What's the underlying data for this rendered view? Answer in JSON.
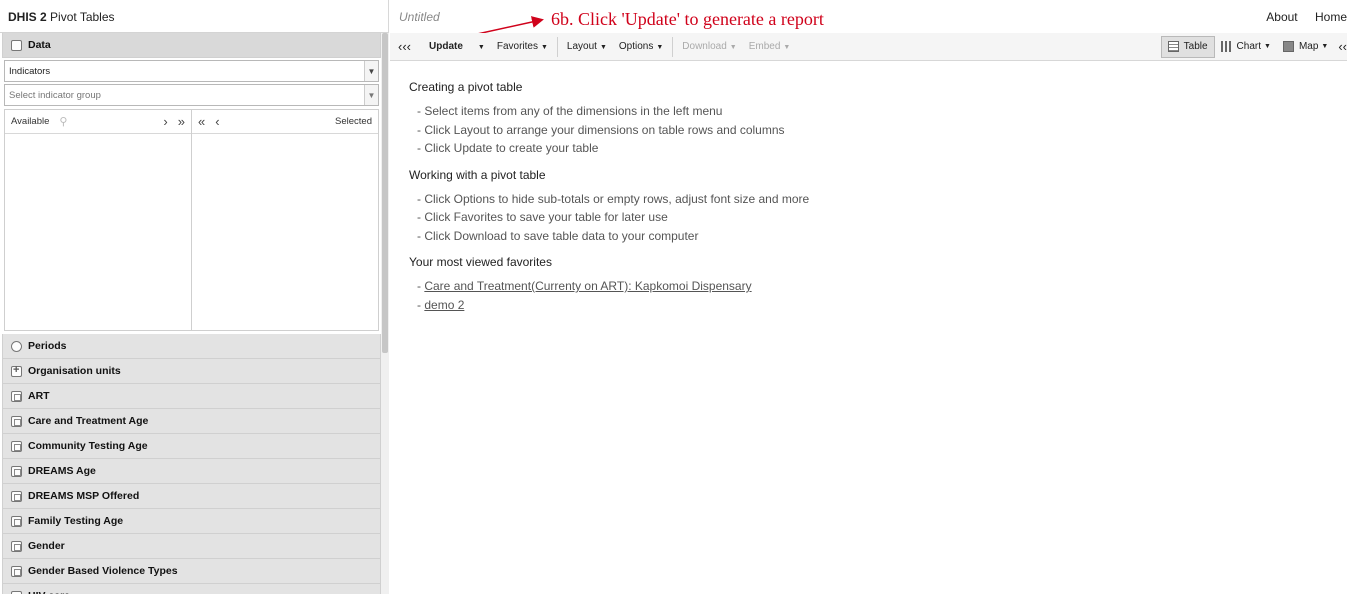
{
  "app": {
    "brand_bold": "DHIS 2",
    "brand_rest": "Pivot Tables"
  },
  "report_title": "Untitled",
  "topnav": {
    "about": "About",
    "home": "Home"
  },
  "annotation": {
    "text": "6b. Click 'Update' to generate a report",
    "color": "#d0021b"
  },
  "data_panel": {
    "title": "Data",
    "type_select": "Indicators",
    "group_placeholder": "Select indicator group",
    "available_label": "Available",
    "selected_label": "Selected"
  },
  "dimensions": [
    {
      "label": "Periods",
      "icon": "clock-icon"
    },
    {
      "label": "Organisation units",
      "icon": "plus-icon"
    },
    {
      "label": "ART",
      "icon": "grid-icon"
    },
    {
      "label": "Care and Treatment Age",
      "icon": "grid-icon"
    },
    {
      "label": "Community Testing Age",
      "icon": "grid-icon"
    },
    {
      "label": "DREAMS Age",
      "icon": "grid-icon"
    },
    {
      "label": "DREAMS MSP Offered",
      "icon": "grid-icon"
    },
    {
      "label": "Family Testing Age",
      "icon": "grid-icon"
    },
    {
      "label": "Gender",
      "icon": "grid-icon"
    },
    {
      "label": "Gender Based Violence Types",
      "icon": "grid-icon"
    },
    {
      "label": "HIV care",
      "icon": "grid-icon"
    }
  ],
  "toolbar": {
    "collapse": "«",
    "update": "Update",
    "favorites": "Favorites",
    "layout": "Layout",
    "options": "Options",
    "download": "Download",
    "embed": "Embed",
    "table": "Table",
    "chart": "Chart",
    "map": "Map"
  },
  "help": {
    "creating_title": "Creating a pivot table",
    "creating_items": [
      "- Select items from any of the dimensions in the left menu",
      "- Click Layout to arrange your dimensions on table rows and columns",
      "- Click Update to create your table"
    ],
    "working_title": "Working with a pivot table",
    "working_items": [
      "- Click Options to hide sub-totals or empty rows, adjust font size and more",
      "- Click Favorites to save your table for later use",
      "- Click Download to save table data to your computer"
    ],
    "favorites_title": "Your most viewed favorites",
    "favorites": [
      "Care and Treatment(Currenty on ART): Kapkomoi Dispensary",
      "demo 2"
    ]
  }
}
